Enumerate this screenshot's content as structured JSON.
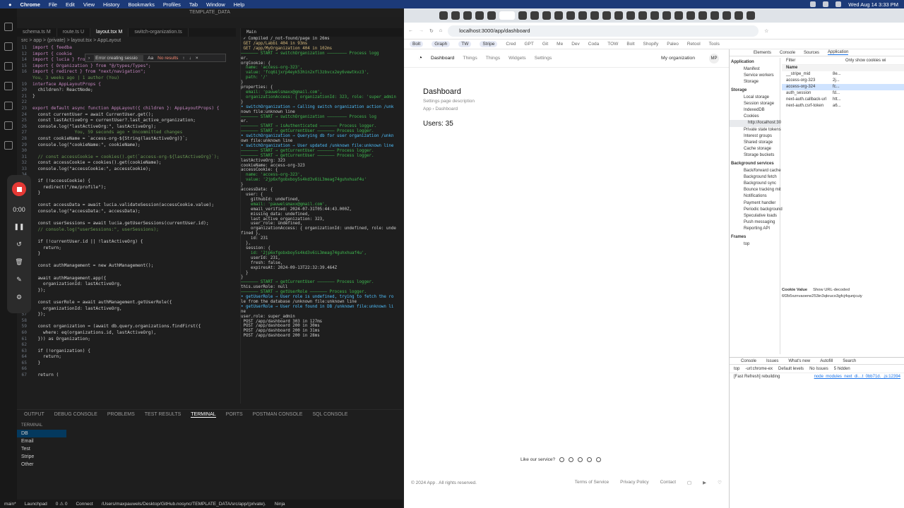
{
  "menubar": {
    "app": "Chrome",
    "items": [
      "File",
      "Edit",
      "View",
      "History",
      "Bookmarks",
      "Profiles",
      "Tab",
      "Window",
      "Help"
    ],
    "clock": "Wed Aug 14  3:33 PM"
  },
  "vscode": {
    "title": "TEMPLATE_DATA",
    "tabs": [
      "schema.ts M",
      "route.ts U",
      "layout.tsx M",
      "switch-organization.ts"
    ],
    "breadcrumb": "src > app > (private) > layout.tsx > AppLayout",
    "find": {
      "value": "Error creating sessio",
      "results": "No results"
    },
    "code_lines": [
      {
        "n": "11",
        "t": "import { feedba"
      },
      {
        "n": "12",
        "t": "import { cookie"
      },
      {
        "n": "14",
        "t": "import { lucia } from \"@/app/server/auth/auth\";"
      },
      {
        "n": "15",
        "t": "import { Organization } from \"@/types/Types\";"
      },
      {
        "n": "16",
        "t": "import { redirect } from \"next/navigation\";"
      },
      {
        "n": "",
        "t": ""
      },
      {
        "n": "",
        "t": "You, 3 weeks ago | 1 author (You)"
      },
      {
        "n": "19",
        "t": "interface AppLayoutProps {"
      },
      {
        "n": "20",
        "t": "  children?: ReactNode;"
      },
      {
        "n": "21",
        "t": "}"
      },
      {
        "n": "22",
        "t": ""
      },
      {
        "n": "23",
        "t": "export default async function AppLayout({ children }: AppLayoutProps) {"
      },
      {
        "n": "24",
        "t": "  const currentUser = await CurrentUser.get();"
      },
      {
        "n": "25",
        "t": "  const lastActiveOrg = currentUser?.last_active_organization;"
      },
      {
        "n": "26",
        "t": "  console.log(\"lastActiveOrg:\", lastActiveOrg);"
      },
      {
        "n": "27",
        "t": "                You, 59 seconds ago • Uncommitted changes"
      },
      {
        "n": "28",
        "t": "  const cookieName = `access-org-${String(lastActiveOrg)}`;"
      },
      {
        "n": "29",
        "t": "  console.log(\"cookieName:\", cookieName);"
      },
      {
        "n": "30",
        "t": ""
      },
      {
        "n": "31",
        "t": "  // const accessCookie = cookies().get(`access-org-${lastActiveOrg}`);"
      },
      {
        "n": "32",
        "t": "  const accessCookie = cookies().get(cookieName);"
      },
      {
        "n": "33",
        "t": "  console.log(\"accessCookie:\", accessCookie);"
      },
      {
        "n": "34",
        "t": ""
      },
      {
        "n": "35",
        "t": "  if (!accessCookie) {"
      },
      {
        "n": "36",
        "t": "    redirect(\"/me/profile\");"
      },
      {
        "n": "37",
        "t": "  }"
      },
      {
        "n": "38",
        "t": ""
      },
      {
        "n": "39",
        "t": "  const accessData = await lucia.validateSession(accessCookie.value);"
      },
      {
        "n": "40",
        "t": "  console.log(\"accessData:\", accessData);"
      },
      {
        "n": "41",
        "t": ""
      },
      {
        "n": "42",
        "t": "  const userSessions = await lucia.getUserSessions(currentUser.id);"
      },
      {
        "n": "43",
        "t": "  // console.log(\"userSessions:\", userSessions);"
      },
      {
        "n": "44",
        "t": ""
      },
      {
        "n": "45",
        "t": "  if (!currentUser.id || !lastActiveOrg) {"
      },
      {
        "n": "46",
        "t": "    return;"
      },
      {
        "n": "47",
        "t": "  }"
      },
      {
        "n": "48",
        "t": ""
      },
      {
        "n": "49",
        "t": "  const authManagement = new AuthManagement();"
      },
      {
        "n": "50",
        "t": ""
      },
      {
        "n": "51",
        "t": "  await authManagement.app({"
      },
      {
        "n": "52",
        "t": "    organizationId: lastActiveOrg,"
      },
      {
        "n": "53",
        "t": "  });"
      },
      {
        "n": "54",
        "t": ""
      },
      {
        "n": "55",
        "t": "  const userRole = await authManagement.getUserRole({"
      },
      {
        "n": "56",
        "t": "    organizationId: lastActiveOrg,"
      },
      {
        "n": "57",
        "t": "  });"
      },
      {
        "n": "58",
        "t": ""
      },
      {
        "n": "59",
        "t": "  const organization = (await db.query.organizations.findFirst({"
      },
      {
        "n": "60",
        "t": "    where: eq(organizations.id, lastActiveOrg),"
      },
      {
        "n": "61",
        "t": "  })) as Organization;"
      },
      {
        "n": "62",
        "t": ""
      },
      {
        "n": "63",
        "t": "  if (!organization) {"
      },
      {
        "n": "64",
        "t": "    return;"
      },
      {
        "n": "65",
        "t": "  }"
      },
      {
        "n": "66",
        "t": ""
      },
      {
        "n": "67",
        "t": "  return ("
      }
    ],
    "output_tab": "Main",
    "output_lines": [
      " ✓ Compiled /_not-found/page in 26ms",
      " GET /app/Labbi 404 in 93ms",
      " GET /app/MyOrganization 404 in 102ms",
      "——————— START → switchOrganization ———————— Process logg",
      "er.",
      "orgCookie: {",
      "  name: 'access-org-323',",
      "  value: 'fcq6ijxrp4eyk53hin2xfl3zbvcx2ey6vewtkvz3',",
      "  path: '/'",
      "}",
      "properties: {",
      "  email: 'pauwelsmaxx@gmail.com',",
      "  organizationAccess: { organizationId: 323, role: 'super_admin",
      "}",
      "• switchOrganization → Calling switch organization action /unk",
      "nown file:unknown line",
      "——————— START → switchOrganization ———————— Process log",
      "er.",
      "——————— START → isAuthenticated ——————— Process logger.",
      "——————— START → getCurrentUser ——————— Process logger.",
      "• switchOrganization → Querying db for user organization /unkn",
      "own file:unknown line",
      "• switchOrganization → User updated /unknown file:unknown line",
      "——————— START → getCurrentUser ——————— Process logger.",
      "——————— START → getCurrentUser ——————— Process logger.",
      "lastActiveOrg: 323",
      "cookieName: access-org-323",
      "accessCookie: {",
      "  name: 'access-org-323',",
      "  value: '2jp6xfgobxboy5s4kd3v6iL3meag74guhxhuaf4u'",
      "}",
      "accessData: {",
      "  user: {",
      "    githubId: undefined,",
      "    email: 'pauwelsmaxx@gmail.com',",
      "    email_verified: 2024-07-31T05:44:43.000Z,",
      "    missing_data: undefined,",
      "    last_active_organization: 323,",
      "    user_role: undefined,",
      "    organizationAccess: { organizationId: undefined, role: unde",
      "fined },",
      "    id: 231",
      "  },",
      "  session: {",
      "    id: '2jp6xfgobxboy5s4kd3v6iL3meag74guhxhuaf4u',",
      "    userId: 231,",
      "    fresh: false,",
      "    expiresAt: 2024-09-13T22:32:39.464Z",
      "  }",
      "}",
      "——————— START → getCurrentUser ——————— Process logger.",
      "this.userRole: null",
      "——————— START → getUserRole ——————— Process logger.",
      "• getUserRole → User role is undefined, trying to fetch the ro",
      "le from the database /unknown file:unknown line",
      "• getUserRole → User role found in DB /unknown file:unknown li",
      "ne",
      "user.role: super_admin",
      " POST /app/dashboard 303 in 127ms",
      " POST /app/dashboard 200 in 30ms",
      " POST /app/dashboard 200 in 31ms",
      " POST /app/dashboard 200 in 28ms"
    ],
    "recorder": {
      "time": "0:00"
    },
    "panel_tabs": [
      "OUTPUT",
      "DEBUG CONSOLE",
      "PROBLEMS",
      "TEST RESULTS",
      "TERMINAL",
      "PORTS",
      "POSTMAN CONSOLE",
      "SQL CONSOLE"
    ],
    "active_panel_tab": "TERMINAL",
    "terminal_heading": "TERMINAL",
    "terminals": [
      "DB",
      "Email",
      "Test",
      "Stripe",
      "Other"
    ],
    "status": [
      "main*",
      "Launchpad",
      "0 ⚠ 0",
      "Connect",
      "/Users/maxpauwels/Desktop/GitHub.nosync/TEMPLATE_DATA/src/app/(private).",
      "Ninja"
    ]
  },
  "chrome": {
    "url": "localhost:3000/app/dashboard",
    "bookmarks": [
      "Bolt",
      "Graph",
      "TW",
      "Stripe",
      "Cred",
      "GPT",
      "Git",
      "Me",
      "Dev",
      "Coda",
      "TOW",
      "Bolt",
      "Shopify",
      "Paleo",
      "Retool",
      "Tools"
    ],
    "page": {
      "nav": [
        "Dashboard",
        "Things",
        "Things",
        "Widgets",
        "Settings"
      ],
      "org": "My organization",
      "avatar": "MP",
      "title": "Dashboard",
      "description": "Settings page description",
      "crumb_root": "App",
      "crumb_current": "Dashboard",
      "users_label": "Users: 35",
      "feedback_q": "Like our service?",
      "copyright": "© 2024 App . All rights reserved.",
      "footer_links": [
        "Terms of Service",
        "Privacy Policy",
        "Contact"
      ]
    },
    "devtools": {
      "tabs": [
        "Elements",
        "Console",
        "Sources",
        "Application"
      ],
      "app_section": "Application",
      "app_items": [
        "Manifest",
        "Service workers",
        "Storage"
      ],
      "storage_section": "Storage",
      "storage_items": [
        "Local storage",
        "Session storage",
        "IndexedDB",
        "Cookies",
        "http://localhost:30",
        "Private state tokens",
        "Interest groups",
        "Shared storage",
        "Cache storage",
        "Storage buckets"
      ],
      "bg_section": "Background services",
      "bg_items": [
        "Back/forward cache",
        "Background fetch",
        "Background sync",
        "Bounce tracking mit",
        "Notifications",
        "Payment handler",
        "Periodic background",
        "Speculative loads",
        "Push messaging",
        "Reporting API"
      ],
      "frames_section": "Frames",
      "frames_items": [
        "top"
      ],
      "filter_placeholder": "Filter",
      "only_issues": "Only show cookies wi",
      "col_name": "Name",
      "cookies": [
        {
          "name": "__stripe_mid",
          "val": "8e..."
        },
        {
          "name": "access-org-323",
          "val": "2j..."
        },
        {
          "name": "access-org-324",
          "val": "fc..."
        },
        {
          "name": "auth_session",
          "val": "fd..."
        },
        {
          "name": "next-auth.callback-url",
          "val": "htt..."
        },
        {
          "name": "next-auth.csrf-token",
          "val": "a6..."
        }
      ],
      "cookie_value_label": "Cookie Value",
      "show_decoded": "Show URL-decoded",
      "cookie_value": "6f2b5xznvaoerw253in3qkruco3gfcj4qunjcuiy",
      "console_tabs": [
        "Console",
        "Issues",
        "What's new",
        "Autofill",
        "Search"
      ],
      "console_context": "top",
      "console_filter": "-url:chrome-ex",
      "levels": "Default levels",
      "no_issues": "No Issues",
      "hidden": "5 hidden",
      "log_text": "[Fast Refresh] rebuilding",
      "log_src": "node_modules_next_di…t_0bb71d._.js:12394"
    }
  }
}
